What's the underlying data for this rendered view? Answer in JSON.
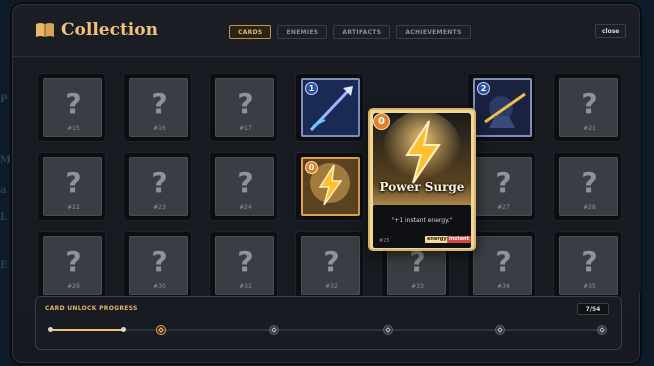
{
  "colors": {
    "accent": "#f1c27a",
    "panel": "#1b1e24",
    "energy": "#d6a54e",
    "cost_blue": "#2b4fa8",
    "cost_orange": "#e0822c"
  },
  "title": "Collection",
  "title_icon": "book-icon",
  "tabs": [
    {
      "label": "CARDS",
      "active": true
    },
    {
      "label": "ENEMIES"
    },
    {
      "label": "ARTIFACTS"
    },
    {
      "label": "ACHIEVEMENTS"
    }
  ],
  "close_label": "close",
  "edge_glyphs": [
    "P",
    "M",
    "a",
    "L",
    "E"
  ],
  "slots": [
    {
      "label": "#15",
      "locked": true
    },
    {
      "label": "#16",
      "locked": true
    },
    {
      "label": "#17",
      "locked": true
    },
    {
      "cost": "1",
      "locked": false,
      "art": "spear-card-art"
    },
    {
      "locked": false,
      "hidden_by_detail": true
    },
    {
      "cost": "2",
      "locked": false,
      "art": "guardian-card-art"
    },
    {
      "label": "#21",
      "locked": true
    },
    {
      "label": "#22",
      "locked": true
    },
    {
      "label": "#23",
      "locked": true
    },
    {
      "label": "#24",
      "locked": true
    },
    {
      "cost": "0",
      "locked": false,
      "art": "lightning-card-art",
      "highlight": true
    },
    {
      "locked": false,
      "hidden_by_detail": true
    },
    {
      "label": "#27",
      "locked": true
    },
    {
      "label": "#28",
      "locked": true
    },
    {
      "label": "#29",
      "locked": true
    },
    {
      "label": "#30",
      "locked": true
    },
    {
      "label": "#31",
      "locked": true
    },
    {
      "label": "#32",
      "locked": true
    },
    {
      "label": "#33",
      "locked": true
    },
    {
      "label": "#34",
      "locked": true
    },
    {
      "label": "#35",
      "locked": true
    }
  ],
  "detail": {
    "cost": "0",
    "name": "Power Surge",
    "description": "\"+1 instant energy.\"",
    "number": "#25",
    "tags": [
      "energy",
      "instant"
    ],
    "art": "lightning-bolt-art"
  },
  "progress": {
    "title": "CARD UNLOCK PROGRESS",
    "count": "7/54",
    "fraction": 0.13
  }
}
